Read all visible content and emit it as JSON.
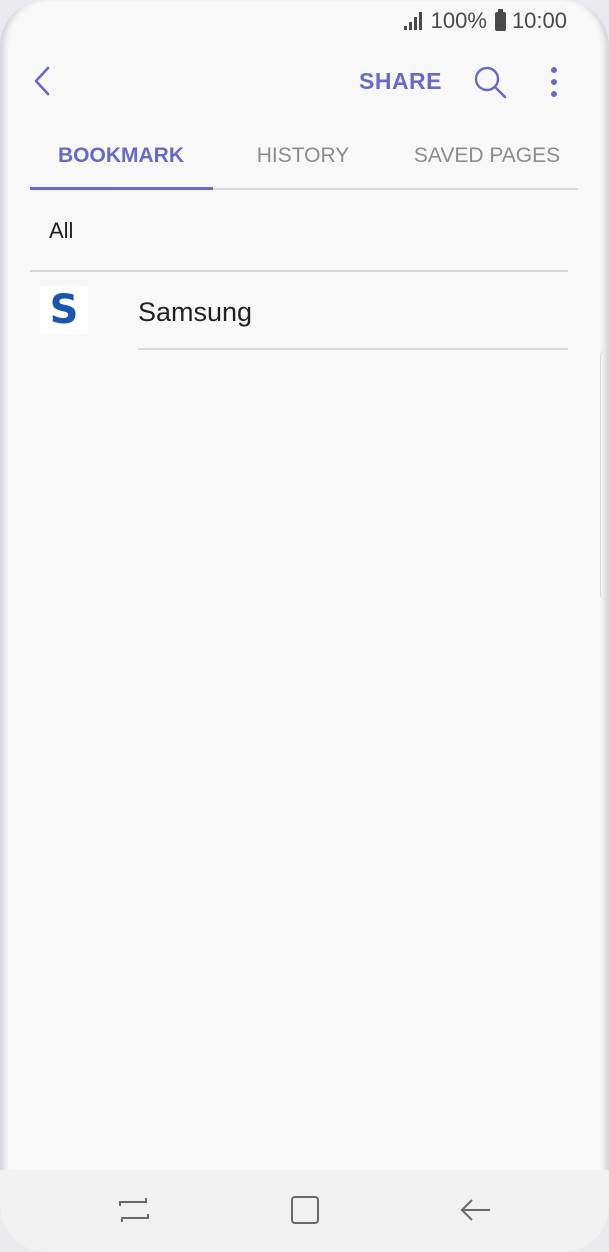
{
  "status_bar": {
    "battery": "100%",
    "time": "10:00",
    "icons": [
      "signal-icon",
      "battery-icon"
    ]
  },
  "toolbar": {
    "share_label": "SHARE",
    "icons": [
      "back-icon",
      "search-icon",
      "more-options-icon"
    ]
  },
  "tabs": [
    {
      "label": "BOOKMARK",
      "active": true
    },
    {
      "label": "HISTORY",
      "active": false
    },
    {
      "label": "SAVED PAGES",
      "active": false
    }
  ],
  "folder": {
    "label": "All"
  },
  "bookmarks": [
    {
      "title": "Samsung",
      "favicon_letter": "S"
    }
  ],
  "nav_bar": {
    "icons": [
      "recent-apps-icon",
      "home-icon",
      "back-nav-icon"
    ]
  },
  "colors": {
    "accent": "#6b69c7",
    "background": "#f8f8f8",
    "favicon": "#1a56b0"
  }
}
